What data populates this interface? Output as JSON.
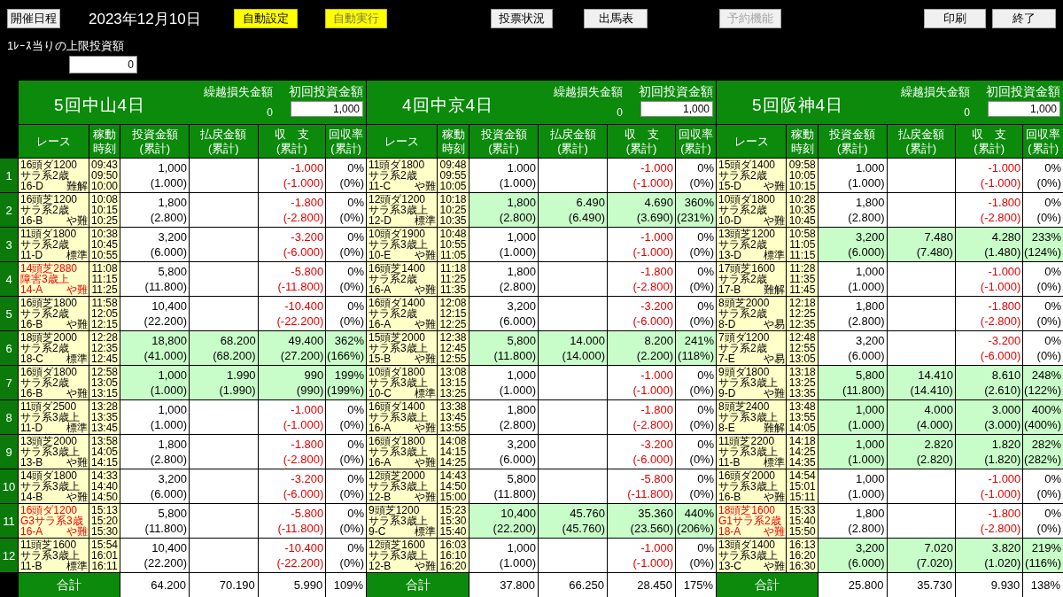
{
  "header": {
    "schedule_button": "開催日程",
    "date": "2023年12月10日",
    "mode_buttons": [
      {
        "label": "自動設定",
        "disabled": false
      },
      {
        "label": "自動実行",
        "disabled": true
      }
    ],
    "center_buttons": [
      {
        "label": "投票状況",
        "disabled": false
      },
      {
        "label": "出馬表",
        "disabled": false
      },
      {
        "label": "予約機能",
        "disabled": true
      }
    ],
    "right_buttons": [
      {
        "label": "印刷",
        "disabled": false
      },
      {
        "label": "終了",
        "disabled": false
      }
    ]
  },
  "limit": {
    "label": "1ﾚｰｽ当りの上限投資額",
    "value": "0"
  },
  "race_numbers": [
    "1",
    "2",
    "3",
    "4",
    "5",
    "6",
    "7",
    "8",
    "9",
    "10",
    "11",
    "12"
  ],
  "venues": [
    {
      "name": "5回中山4日",
      "carryover_label": "繰越損失金額",
      "carryover": "0",
      "initial_label": "初回投資金額",
      "initial_value": "1,000",
      "columns": [
        {
          "lines": [
            "レース"
          ]
        },
        {
          "lines": [
            "稼動",
            "時刻"
          ]
        },
        {
          "lines": [
            "投資金額",
            "(累計)"
          ]
        },
        {
          "lines": [
            "払戻金額",
            "(累計)"
          ]
        },
        {
          "lines": [
            "収　支",
            "(累計)"
          ]
        },
        {
          "lines": [
            "回収率",
            "(累計)"
          ]
        }
      ],
      "races": [
        {
          "line_1": "16頭ダ1200",
          "line_2": "サラ系2歳",
          "code": "16-D",
          "rating": "難解",
          "highlighted": false,
          "times": [
            "09:43",
            "09:50",
            "10:00"
          ],
          "investment": "1,000",
          "investment_cum": "(1.000)",
          "balance": "-1.000",
          "balance_cum": "(-1.000)",
          "rate": "0%",
          "rate_cum": "(0%)",
          "hit": false
        },
        {
          "line_1": "16頭芝1200",
          "line_2": "サラ系2歳",
          "code": "16-B",
          "rating": "や難",
          "highlighted": false,
          "times": [
            "10:08",
            "10:15",
            "10:25"
          ],
          "investment": "1,800",
          "investment_cum": "(2.800)",
          "balance": "-1.800",
          "balance_cum": "(-2.800)",
          "rate": "0%",
          "rate_cum": "(0%)",
          "hit": false
        },
        {
          "line_1": "11頭ダ1800",
          "line_2": "サラ系2歳",
          "code": "11-D",
          "rating": "標準",
          "highlighted": false,
          "times": [
            "10:38",
            "10:45",
            "10:55"
          ],
          "investment": "3,200",
          "investment_cum": "(6.000)",
          "balance": "-3.200",
          "balance_cum": "(-6.000)",
          "rate": "0%",
          "rate_cum": "(0%)",
          "hit": false
        },
        {
          "line_1": "14頭芝2880",
          "line_2": "障害3歳上",
          "code": "14-A",
          "rating": "や難",
          "highlighted": true,
          "times": [
            "11:08",
            "11:15",
            "11:25"
          ],
          "investment": "5,800",
          "investment_cum": "(11.800)",
          "balance": "-5.800",
          "balance_cum": "(-11.800)",
          "rate": "0%",
          "rate_cum": "(0%)",
          "hit": false
        },
        {
          "line_1": "16頭芝1800",
          "line_2": "サラ系2歳",
          "code": "16-B",
          "rating": "や難",
          "highlighted": false,
          "times": [
            "11:58",
            "12:05",
            "12:15"
          ],
          "investment": "10,400",
          "investment_cum": "(22.200)",
          "balance": "-10.400",
          "balance_cum": "(-22.200)",
          "rate": "0%",
          "rate_cum": "(0%)",
          "hit": false
        },
        {
          "line_1": "18頭芝2000",
          "line_2": "サラ系2歳",
          "code": "18-C",
          "rating": "標準",
          "highlighted": false,
          "times": [
            "12:28",
            "12:35",
            "12:45"
          ],
          "investment": "18,800",
          "investment_cum": "(41.000)",
          "payout": "68.200",
          "payout_cum": "(68.200)",
          "balance": "49.400",
          "balance_cum": "(27.200)",
          "rate": "362%",
          "rate_cum": "(166%)",
          "hit": true
        },
        {
          "line_1": "16頭ダ1800",
          "line_2": "サラ系2歳",
          "code": "16-B",
          "rating": "や難",
          "highlighted": false,
          "times": [
            "12:58",
            "13:05",
            "13:15"
          ],
          "investment": "1,000",
          "investment_cum": "(1.000)",
          "payout": "1.990",
          "payout_cum": "(1.990)",
          "balance": "990",
          "balance_cum": "(990)",
          "rate": "199%",
          "rate_cum": "(199%)",
          "hit": true
        },
        {
          "line_1": "11頭ダ2500",
          "line_2": "サラ系3歳上",
          "code": "11-D",
          "rating": "標準",
          "highlighted": false,
          "times": [
            "13:28",
            "13:35",
            "13:45"
          ],
          "investment": "1,000",
          "investment_cum": "(1.000)",
          "balance": "-1.000",
          "balance_cum": "(-1.000)",
          "rate": "0%",
          "rate_cum": "(0%)",
          "hit": false
        },
        {
          "line_1": "13頭芝2000",
          "line_2": "サラ系3歳上",
          "code": "13-B",
          "rating": "や難",
          "highlighted": false,
          "times": [
            "13:58",
            "14:05",
            "14:15"
          ],
          "investment": "1,800",
          "investment_cum": "(2.800)",
          "balance": "-1.800",
          "balance_cum": "(-2.800)",
          "rate": "0%",
          "rate_cum": "(0%)",
          "hit": false
        },
        {
          "line_1": "14頭ダ1800",
          "line_2": "サラ系3歳上",
          "code": "14-B",
          "rating": "や難",
          "highlighted": false,
          "times": [
            "14:33",
            "14:40",
            "14:50"
          ],
          "investment": "3,200",
          "investment_cum": "(6.000)",
          "balance": "-3.200",
          "balance_cum": "(-6.000)",
          "rate": "0%",
          "rate_cum": "(0%)",
          "hit": false
        },
        {
          "line_1": "16頭ダ1200",
          "line_2": "G3サラ系3歳",
          "code": "16-A",
          "rating": "や難",
          "highlighted": true,
          "times": [
            "15:13",
            "15:20",
            "15:30"
          ],
          "investment": "5,800",
          "investment_cum": "(11.800)",
          "balance": "-5.800",
          "balance_cum": "(-11.800)",
          "rate": "0%",
          "rate_cum": "(0%)",
          "hit": false
        },
        {
          "line_1": "11頭芝1600",
          "line_2": "サラ系3歳上",
          "code": "11-B",
          "rating": "標準",
          "highlighted": false,
          "times": [
            "15:54",
            "16:01",
            "16:11"
          ],
          "investment": "10,400",
          "investment_cum": "(22.200)",
          "balance": "-10.400",
          "balance_cum": "(-22.200)",
          "rate": "0%",
          "rate_cum": "(0%)",
          "hit": false
        }
      ],
      "totals": {
        "label": "合計",
        "investment": "64.200",
        "payout": "70.190",
        "balance": "5.990",
        "rate": "109%"
      }
    },
    {
      "name": "4回中京4日",
      "carryover_label": "繰越損失金額",
      "carryover": "0",
      "initial_label": "初回投資金額",
      "initial_value": "1,000",
      "columns": [
        {
          "lines": [
            "レース"
          ]
        },
        {
          "lines": [
            "稼動",
            "時刻"
          ]
        },
        {
          "lines": [
            "投資金額",
            "(累計)"
          ]
        },
        {
          "lines": [
            "払戻金額",
            "(累計)"
          ]
        },
        {
          "lines": [
            "収　支",
            "(累計)"
          ]
        },
        {
          "lines": [
            "回収率",
            "(累計)"
          ]
        }
      ],
      "races": [
        {
          "line_1": "11頭ダ1800",
          "line_2": "サラ系2歳",
          "code": "11-C",
          "rating": "や難",
          "highlighted": false,
          "times": [
            "09:48",
            "09:55",
            "10:05"
          ],
          "investment": "1.000",
          "investment_cum": "(1.000)",
          "balance": "-1.000",
          "balance_cum": "(-1.000)",
          "rate": "0%",
          "rate_cum": "(0%)",
          "hit": false
        },
        {
          "line_1": "12頭ダ1200",
          "line_2": "サラ系3歳上",
          "code": "12-D",
          "rating": "標準",
          "highlighted": false,
          "times": [
            "10:18",
            "10:25",
            "10:35"
          ],
          "investment": "1,800",
          "investment_cum": "(2.800)",
          "payout": "6.490",
          "payout_cum": "(6.490)",
          "balance": "4.690",
          "balance_cum": "(3.690)",
          "rate": "360%",
          "rate_cum": "(231%)",
          "hit": true
        },
        {
          "line_1": "10頭ダ1900",
          "line_2": "サラ系3歳上",
          "code": "10-E",
          "rating": "や難",
          "highlighted": false,
          "times": [
            "10:48",
            "10:55",
            "11:05"
          ],
          "investment": "1,000",
          "investment_cum": "(1.000)",
          "balance": "-1.000",
          "balance_cum": "(-1.000)",
          "rate": "0%",
          "rate_cum": "(0%)",
          "hit": false
        },
        {
          "line_1": "16頭芝1400",
          "line_2": "サラ系2歳",
          "code": "16-A",
          "rating": "や難",
          "highlighted": false,
          "times": [
            "11:18",
            "11:25",
            "11:35"
          ],
          "investment": "1,800",
          "investment_cum": "(2.800)",
          "balance": "-1.800",
          "balance_cum": "(-2.800)",
          "rate": "0%",
          "rate_cum": "(0%)",
          "hit": false
        },
        {
          "line_1": "16頭ダ1400",
          "line_2": "サラ系2歳",
          "code": "16-A",
          "rating": "や難",
          "highlighted": false,
          "times": [
            "12:08",
            "12:15",
            "12:25"
          ],
          "investment": "3,200",
          "investment_cum": "(6.000)",
          "balance": "-3.200",
          "balance_cum": "(-6.000)",
          "rate": "0%",
          "rate_cum": "(0%)",
          "hit": false
        },
        {
          "line_1": "15頭芝2000",
          "line_2": "サラ系3歳上",
          "code": "15-B",
          "rating": "や難",
          "highlighted": false,
          "times": [
            "12:38",
            "12:45",
            "12:55"
          ],
          "investment": "5,800",
          "investment_cum": "(11.800)",
          "payout": "14.000",
          "payout_cum": "(14.000)",
          "balance": "8.200",
          "balance_cum": "(2.200)",
          "rate": "241%",
          "rate_cum": "(118%)",
          "hit": true
        },
        {
          "line_1": "10頭ダ1800",
          "line_2": "サラ系3歳上",
          "code": "10-C",
          "rating": "標準",
          "highlighted": false,
          "times": [
            "13:08",
            "13:15",
            "13:25"
          ],
          "investment": "1,000",
          "investment_cum": "(1.000)",
          "balance": "-1.000",
          "balance_cum": "(-1.000)",
          "rate": "0%",
          "rate_cum": "(0%)",
          "hit": false
        },
        {
          "line_1": "16頭ダ1400",
          "line_2": "サラ系3歳上",
          "code": "16-A",
          "rating": "や難",
          "highlighted": false,
          "times": [
            "13:38",
            "13:45",
            "13:55"
          ],
          "investment": "1,800",
          "investment_cum": "(2.800)",
          "balance": "-1.800",
          "balance_cum": "(-2.800)",
          "rate": "0%",
          "rate_cum": "(0%)",
          "hit": false
        },
        {
          "line_1": "16頭ダ1800",
          "line_2": "サラ系3歳上",
          "code": "16-A",
          "rating": "や難",
          "highlighted": false,
          "times": [
            "14:08",
            "14:15",
            "14:25"
          ],
          "investment": "3,200",
          "investment_cum": "(6.000)",
          "balance": "-3.200",
          "balance_cum": "(-6.000)",
          "rate": "0%",
          "rate_cum": "(0%)",
          "hit": false
        },
        {
          "line_1": "12頭芝2000",
          "line_2": "サラ系3歳上",
          "code": "12-B",
          "rating": "や難",
          "highlighted": false,
          "times": [
            "14:43",
            "14:50",
            "15:00"
          ],
          "investment": "5,800",
          "investment_cum": "(11.800)",
          "balance": "-5.800",
          "balance_cum": "(-11.800)",
          "rate": "0%",
          "rate_cum": "(0%)",
          "hit": false
        },
        {
          "line_1": "9頭芝1200",
          "line_2": "サラ系3歳上",
          "code": "9-C",
          "rating": "標準",
          "highlighted": false,
          "times": [
            "15:23",
            "15:30",
            "15:40"
          ],
          "investment": "10,400",
          "investment_cum": "(22.200)",
          "payout": "45.760",
          "payout_cum": "(45.760)",
          "balance": "35.360",
          "balance_cum": "(23.560)",
          "rate": "440%",
          "rate_cum": "(206%)",
          "hit": true
        },
        {
          "line_1": "12頭芝1600",
          "line_2": "サラ系3歳上",
          "code": "12-B",
          "rating": "や難",
          "highlighted": false,
          "times": [
            "16:03",
            "16:10",
            "16:20"
          ],
          "investment": "1,000",
          "investment_cum": "(1.000)",
          "balance": "-1.000",
          "balance_cum": "(-1.000)",
          "rate": "0%",
          "rate_cum": "(0%)",
          "hit": false
        }
      ],
      "totals": {
        "label": "合計",
        "investment": "37.800",
        "payout": "66.250",
        "balance": "28.450",
        "rate": "175%"
      }
    },
    {
      "name": "5回阪神4日",
      "carryover_label": "繰越損失金額",
      "carryover": "0",
      "initial_label": "初回投資金額",
      "initial_value": "1,000",
      "columns": [
        {
          "lines": [
            "レース"
          ]
        },
        {
          "lines": [
            "稼動",
            "時刻"
          ]
        },
        {
          "lines": [
            "投資金額",
            "(累計)"
          ]
        },
        {
          "lines": [
            "払戻金額",
            "(累計)"
          ]
        },
        {
          "lines": [
            "収　支",
            "(累計)"
          ]
        },
        {
          "lines": [
            "回収率",
            "(累計)"
          ]
        }
      ],
      "races": [
        {
          "line_1": "15頭ダ1400",
          "line_2": "サラ系2歳",
          "code": "15-D",
          "rating": "や難",
          "highlighted": false,
          "times": [
            "09:58",
            "10:05",
            "10:15"
          ],
          "investment": "1.000",
          "investment_cum": "(1.000)",
          "balance": "-1.000",
          "balance_cum": "(-1.000)",
          "rate": "0%",
          "rate_cum": "(0%)",
          "hit": false
        },
        {
          "line_1": "10頭ダ1800",
          "line_2": "サラ系2歳",
          "code": "10-D",
          "rating": "や難",
          "highlighted": false,
          "times": [
            "10:28",
            "10:35",
            "10:45"
          ],
          "investment": "1,800",
          "investment_cum": "(2.800)",
          "balance": "-1.800",
          "balance_cum": "(-2.800)",
          "rate": "0%",
          "rate_cum": "(0%)",
          "hit": false
        },
        {
          "line_1": "13頭芝1200",
          "line_2": "サラ系2歳",
          "code": "13-D",
          "rating": "標準",
          "highlighted": false,
          "times": [
            "10:58",
            "11:05",
            "11:15"
          ],
          "investment": "3,200",
          "investment_cum": "(6.000)",
          "payout": "7.480",
          "payout_cum": "(7.480)",
          "balance": "4.280",
          "balance_cum": "(1.480)",
          "rate": "233%",
          "rate_cum": "(124%)",
          "hit": true
        },
        {
          "line_1": "17頭芝1600",
          "line_2": "サラ系2歳",
          "code": "17-B",
          "rating": "難解",
          "highlighted": false,
          "times": [
            "11:28",
            "11:35",
            "11:45"
          ],
          "investment": "1,000",
          "investment_cum": "(1.000)",
          "balance": "-1.000",
          "balance_cum": "(-1.000)",
          "rate": "0%",
          "rate_cum": "(0%)",
          "hit": false
        },
        {
          "line_1": "8頭芝2000",
          "line_2": "サラ系2歳",
          "code": "8-D",
          "rating": "や易",
          "highlighted": false,
          "times": [
            "12:18",
            "12:25",
            "12:35"
          ],
          "investment": "1,800",
          "investment_cum": "(2.800)",
          "balance": "-1.800",
          "balance_cum": "(-2.800)",
          "rate": "0%",
          "rate_cum": "(0%)",
          "hit": false
        },
        {
          "line_1": "7頭ダ1200",
          "line_2": "サラ系2歳",
          "code": "7-E",
          "rating": "や易",
          "highlighted": false,
          "times": [
            "12:48",
            "12:55",
            "13:05"
          ],
          "investment": "3,200",
          "investment_cum": "(6.000)",
          "balance": "-3.200",
          "balance_cum": "(-6.000)",
          "rate": "0%",
          "rate_cum": "(0%)",
          "hit": false
        },
        {
          "line_1": "9頭ダ1800",
          "line_2": "サラ系3歳上",
          "code": "9-D",
          "rating": "や難",
          "highlighted": false,
          "times": [
            "13:18",
            "13:25",
            "13:35"
          ],
          "investment": "5,800",
          "investment_cum": "(11.800)",
          "payout": "14.410",
          "payout_cum": "(14.410)",
          "balance": "8.610",
          "balance_cum": "(2.610)",
          "rate": "248%",
          "rate_cum": "(122%)",
          "hit": true
        },
        {
          "line_1": "8頭芝2400",
          "line_2": "サラ系3歳上",
          "code": "8-E",
          "rating": "難解",
          "highlighted": false,
          "times": [
            "13:48",
            "13:55",
            "14:05"
          ],
          "investment": "1,000",
          "investment_cum": "(1.000)",
          "payout": "4.000",
          "payout_cum": "(4.000)",
          "balance": "3.000",
          "balance_cum": "(3.000)",
          "rate": "400%",
          "rate_cum": "(400%)",
          "hit": true
        },
        {
          "line_1": "11頭芝2200",
          "line_2": "サラ系3歳上",
          "code": "11-B",
          "rating": "標準",
          "highlighted": false,
          "times": [
            "14:18",
            "14:25",
            "14:35"
          ],
          "investment": "1,000",
          "investment_cum": "(1.000)",
          "payout": "2.820",
          "payout_cum": "(2.820)",
          "balance": "1.820",
          "balance_cum": "(1.820)",
          "rate": "282%",
          "rate_cum": "(282%)",
          "hit": true
        },
        {
          "line_1": "16頭ダ2000",
          "line_2": "サラ系3歳上",
          "code": "16-B",
          "rating": "や難",
          "highlighted": false,
          "times": [
            "14:54",
            "15:01",
            "15:11"
          ],
          "investment": "1,000",
          "investment_cum": "(1.000)",
          "balance": "-1.000",
          "balance_cum": "(-1.000)",
          "rate": "0%",
          "rate_cum": "(0%)",
          "hit": false
        },
        {
          "line_1": "18頭芝1600",
          "line_2": "G1サラ系2歳",
          "code": "18-A",
          "rating": "や難",
          "highlighted": true,
          "times": [
            "15:33",
            "15:40",
            "15:50"
          ],
          "investment": "1,800",
          "investment_cum": "(2.800)",
          "balance": "-1.800",
          "balance_cum": "(-2.800)",
          "rate": "0%",
          "rate_cum": "(0%)",
          "hit": false
        },
        {
          "line_1": "13頭ダ1400",
          "line_2": "サラ系3歳上",
          "code": "13-C",
          "rating": "や難",
          "highlighted": false,
          "times": [
            "16:13",
            "16:20",
            "16:30"
          ],
          "investment": "3,200",
          "investment_cum": "(6.000)",
          "payout": "7.020",
          "payout_cum": "(7.020)",
          "balance": "3.820",
          "balance_cum": "(1.020)",
          "rate": "219%",
          "rate_cum": "(116%)",
          "hit": true
        }
      ],
      "totals": {
        "label": "合計",
        "investment": "25.800",
        "payout": "35.730",
        "balance": "9.930",
        "rate": "138%"
      }
    }
  ]
}
